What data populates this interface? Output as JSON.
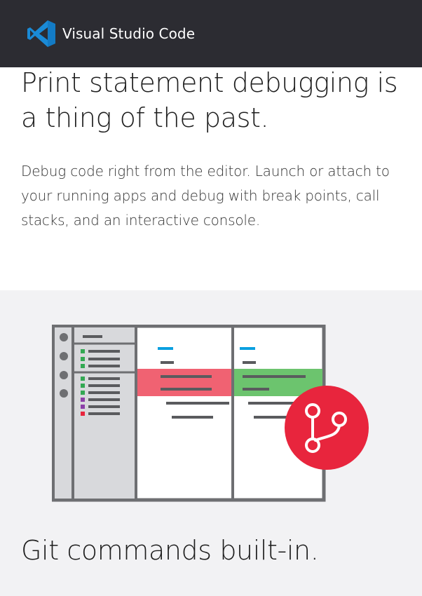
{
  "header": {
    "brand": "Visual Studio Code",
    "logo_icon": "vscode-logo-icon",
    "bg_color": "#2c2c32",
    "logo_color": "#1a8ad6"
  },
  "debug_section": {
    "title": "Print statement debugging is a thing of the past.",
    "description": "Debug code right from the editor. Launch or attach to your running apps and debug with break points, call stacks, and an interactive console."
  },
  "git_section": {
    "title": "Git commands built-in.",
    "illustration_icon": "git-branch-icon",
    "accent_color": "#e8253d",
    "diff_removed_color": "#f06272",
    "diff_added_color": "#6cc46e",
    "background": "#f2f2f4"
  }
}
